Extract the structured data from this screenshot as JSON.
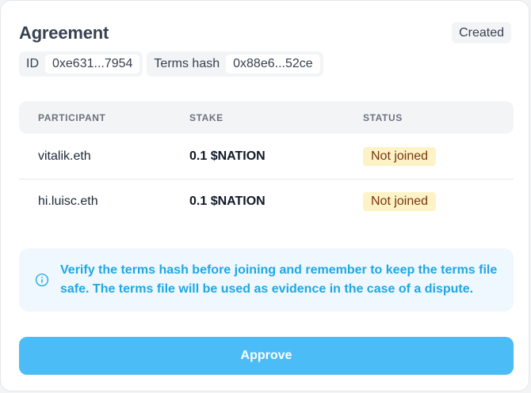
{
  "agreement": {
    "title": "Agreement",
    "status": "Created",
    "id_label": "ID",
    "id_value": "0xe631...7954",
    "terms_hash_label": "Terms hash",
    "terms_hash_value": "0x88e6...52ce"
  },
  "participants_table": {
    "headers": [
      "PARTICIPANT",
      "STAKE",
      "STATUS"
    ],
    "rows": [
      {
        "participant": "vitalik.eth",
        "stake": "0.1 $NATION",
        "status": "Not joined"
      },
      {
        "participant": "hi.luisc.eth",
        "stake": "0.1 $NATION",
        "status": "Not joined"
      }
    ]
  },
  "notice": {
    "icon": "info-icon",
    "text": "Verify the terms hash before joining and remember to keep the terms file safe. The terms file will be used as evidence in the case of a dispute."
  },
  "actions": {
    "approve_label": "Approve"
  },
  "colors": {
    "accent": "#4cbcf7",
    "notice_text": "#1ea7e4",
    "badge_bg": "#fef3c7"
  }
}
